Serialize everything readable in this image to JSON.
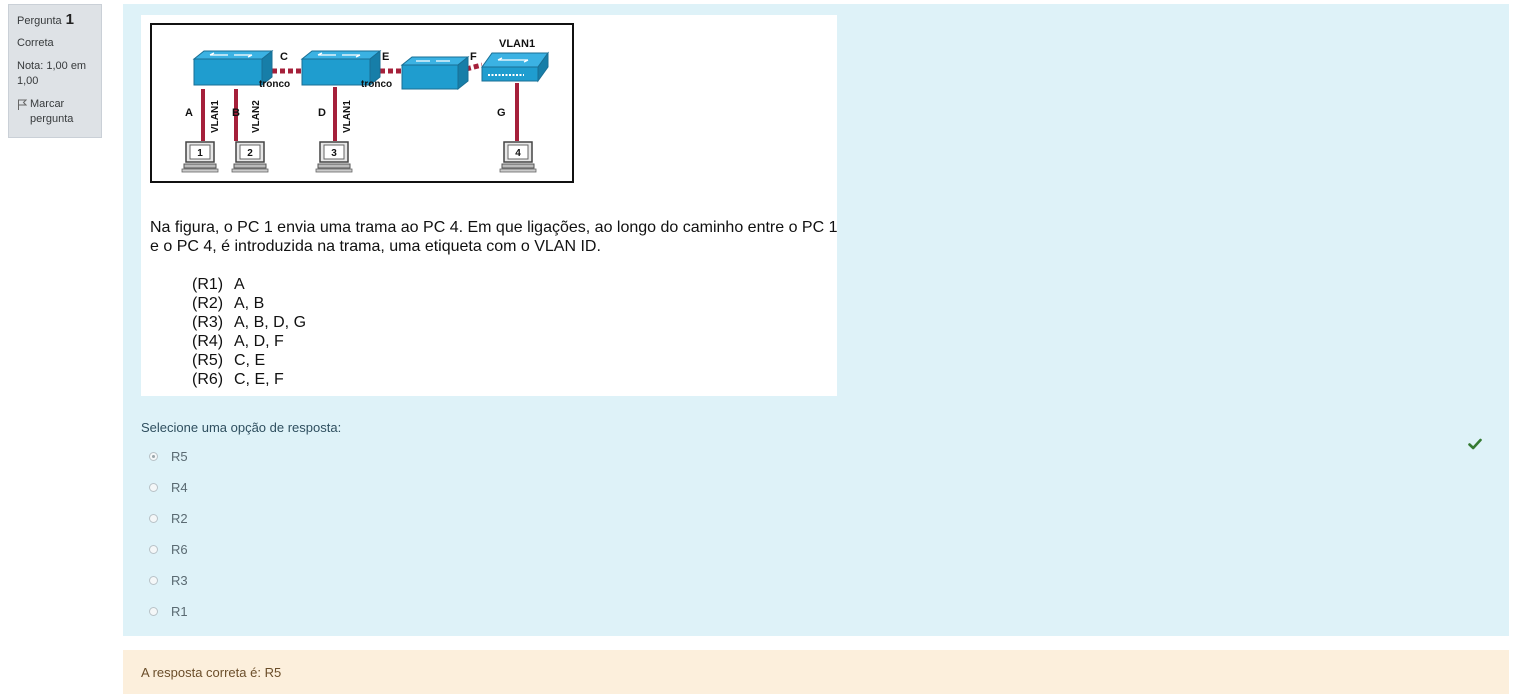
{
  "info": {
    "question_label": "Pergunta",
    "question_number": "1",
    "state": "Correta",
    "grade": "Nota: 1,00 em 1,00",
    "flag_label": "Marcar pergunta"
  },
  "figure": {
    "labels": {
      "link_a": "A",
      "link_b": "B",
      "link_c": "C",
      "link_d": "D",
      "link_e": "E",
      "link_f": "F",
      "link_g": "G",
      "trunk1": "tronco",
      "trunk2": "tronco",
      "vlan_a": "VLAN1",
      "vlan_b": "VLAN2",
      "vlan_d": "VLAN1",
      "vlan_top": "VLAN1",
      "pc1": "1",
      "pc2": "2",
      "pc3": "3",
      "pc4": "4"
    },
    "question_text": "Na figura, o PC 1 envia uma trama ao PC 4. Em que ligações, ao longo do caminho entre o PC 1 e o PC 4, é introduzida na trama, uma etiqueta com o VLAN ID.",
    "options": [
      {
        "code": "(R1)",
        "text": "A"
      },
      {
        "code": "(R2)",
        "text": "A, B"
      },
      {
        "code": "(R3)",
        "text": "A, B, D, G"
      },
      {
        "code": "(R4)",
        "text": "A, D, F"
      },
      {
        "code": "(R5)",
        "text": "C, E"
      },
      {
        "code": "(R6)",
        "text": "C, E, F"
      }
    ]
  },
  "prompt": "Selecione uma opção de resposta:",
  "answers": [
    {
      "label": "R5",
      "selected": true
    },
    {
      "label": "R4",
      "selected": false
    },
    {
      "label": "R2",
      "selected": false
    },
    {
      "label": "R6",
      "selected": false
    },
    {
      "label": "R3",
      "selected": false
    },
    {
      "label": "R1",
      "selected": false
    }
  ],
  "feedback": "A resposta correta é: R5",
  "colors": {
    "panel": "#def2f8",
    "feedback_bg": "#fcefdc",
    "check": "#357a32",
    "switch": "#1f9dcf",
    "cable": "#a5203a"
  },
  "icons": {
    "flag": "flag-icon",
    "check": "check-icon"
  }
}
